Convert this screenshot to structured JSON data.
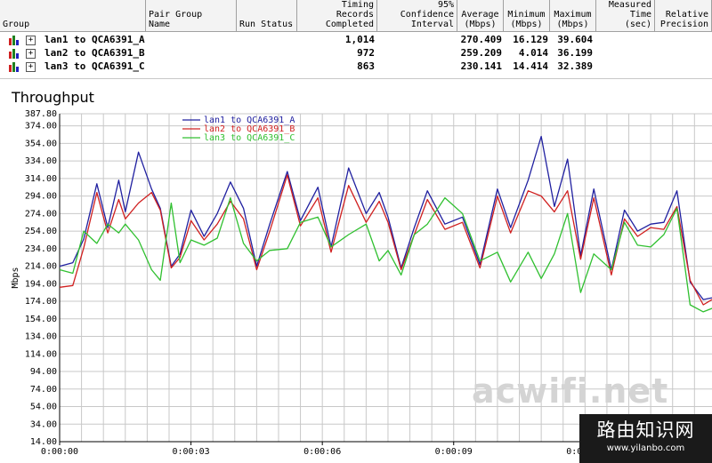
{
  "table": {
    "headers": [
      {
        "lines": [
          "Group"
        ]
      },
      {
        "lines": [
          "Pair Group",
          "Name"
        ]
      },
      {
        "lines": [
          "Run Status"
        ]
      },
      {
        "lines": [
          "Timing Records",
          "Completed"
        ]
      },
      {
        "lines": [
          "95% Confidence",
          "Interval"
        ]
      },
      {
        "lines": [
          "Average",
          "(Mbps)"
        ]
      },
      {
        "lines": [
          "Minimum",
          "(Mbps)"
        ]
      },
      {
        "lines": [
          "Maximum",
          "(Mbps)"
        ]
      },
      {
        "lines": [
          "Measured",
          "Time (sec)"
        ]
      },
      {
        "lines": [
          "Relative",
          "Precision"
        ]
      }
    ],
    "rows": [
      {
        "name": "lan1 to QCA6391_A",
        "records": "1,014",
        "average": "270.409",
        "minimum": "16.129",
        "maximum": "39.604"
      },
      {
        "name": "lan2 to QCA6391_B",
        "records": "972",
        "average": "259.209",
        "minimum": "4.014",
        "maximum": "36.199"
      },
      {
        "name": "lan3 to QCA6391_C",
        "records": "863",
        "average": "230.141",
        "minimum": "14.414",
        "maximum": "32.389"
      }
    ]
  },
  "chart_data": {
    "type": "line",
    "title": "Throughput",
    "ylabel": "Mbps",
    "xlabel": "",
    "ylim": [
      14.0,
      387.8
    ],
    "xlim": [
      0,
      14.9
    ],
    "y_ticks": [
      "387.80",
      "374.00",
      "354.00",
      "334.00",
      "314.00",
      "294.00",
      "274.00",
      "254.00",
      "234.00",
      "214.00",
      "194.00",
      "174.00",
      "154.00",
      "134.00",
      "114.00",
      "94.00",
      "74.00",
      "54.00",
      "34.00",
      "14.00"
    ],
    "x_ticks": [
      {
        "t": 0,
        "label": "0:00:00"
      },
      {
        "t": 3,
        "label": "0:00:03"
      },
      {
        "t": 6,
        "label": "0:00:06"
      },
      {
        "t": 9,
        "label": "0:00:09"
      },
      {
        "t": 12,
        "label": "0:00:12"
      }
    ],
    "grid": true,
    "legend": "top-left",
    "series": [
      {
        "name": "lan1 to QCA6391_A",
        "color": "#2020a0",
        "x": [
          0,
          0.3,
          0.55,
          0.85,
          1.1,
          1.35,
          1.5,
          1.8,
          2.1,
          2.3,
          2.55,
          2.75,
          3.0,
          3.3,
          3.6,
          3.9,
          4.2,
          4.5,
          4.8,
          5.2,
          5.5,
          5.9,
          6.2,
          6.6,
          7.0,
          7.3,
          7.5,
          7.8,
          8.1,
          8.4,
          8.8,
          9.2,
          9.6,
          10.0,
          10.3,
          10.7,
          11.0,
          11.3,
          11.6,
          11.9,
          12.2,
          12.6,
          12.9,
          13.2,
          13.5,
          13.8,
          14.1,
          14.4,
          14.7,
          14.9
        ],
        "y": [
          214,
          218,
          245,
          308,
          258,
          312,
          276,
          344,
          302,
          280,
          214,
          228,
          278,
          248,
          274,
          310,
          280,
          214,
          262,
          322,
          266,
          304,
          236,
          326,
          274,
          298,
          270,
          212,
          258,
          300,
          262,
          270,
          216,
          302,
          258,
          312,
          362,
          282,
          336,
          226,
          302,
          210,
          278,
          254,
          262,
          264,
          300,
          196,
          176,
          178
        ]
      },
      {
        "name": "lan2 to QCA6391_B",
        "color": "#d02020",
        "x": [
          0,
          0.3,
          0.55,
          0.85,
          1.1,
          1.35,
          1.5,
          1.8,
          2.1,
          2.3,
          2.55,
          2.75,
          3.0,
          3.3,
          3.6,
          3.9,
          4.2,
          4.5,
          4.8,
          5.2,
          5.5,
          5.9,
          6.2,
          6.6,
          7.0,
          7.3,
          7.5,
          7.8,
          8.1,
          8.4,
          8.8,
          9.2,
          9.6,
          10.0,
          10.3,
          10.7,
          11.0,
          11.3,
          11.6,
          11.9,
          12.2,
          12.6,
          12.9,
          13.2,
          13.5,
          13.8,
          14.1,
          14.4,
          14.7,
          14.9
        ],
        "y": [
          190,
          192,
          235,
          298,
          252,
          290,
          268,
          286,
          298,
          278,
          212,
          224,
          266,
          244,
          262,
          288,
          268,
          210,
          254,
          318,
          260,
          292,
          230,
          306,
          264,
          288,
          264,
          210,
          250,
          290,
          256,
          264,
          212,
          294,
          252,
          300,
          294,
          276,
          300,
          222,
          292,
          204,
          268,
          248,
          258,
          256,
          282,
          198,
          170,
          176
        ]
      },
      {
        "name": "lan3 to QCA6391_C",
        "color": "#30c030",
        "x": [
          0,
          0.3,
          0.55,
          0.85,
          1.1,
          1.35,
          1.5,
          1.8,
          2.1,
          2.3,
          2.55,
          2.75,
          3.0,
          3.3,
          3.6,
          3.9,
          4.2,
          4.5,
          4.8,
          5.2,
          5.5,
          5.9,
          6.2,
          6.6,
          7.0,
          7.3,
          7.5,
          7.8,
          8.1,
          8.4,
          8.8,
          9.2,
          9.6,
          10.0,
          10.3,
          10.7,
          11.0,
          11.3,
          11.6,
          11.9,
          12.2,
          12.6,
          12.9,
          13.2,
          13.5,
          13.8,
          14.1,
          14.4,
          14.7,
          14.9
        ],
        "y": [
          210,
          206,
          254,
          240,
          262,
          252,
          262,
          244,
          210,
          198,
          286,
          218,
          244,
          238,
          246,
          292,
          240,
          220,
          232,
          234,
          264,
          270,
          236,
          250,
          262,
          220,
          232,
          204,
          250,
          262,
          292,
          274,
          220,
          230,
          196,
          230,
          200,
          228,
          274,
          184,
          228,
          210,
          264,
          238,
          236,
          250,
          280,
          170,
          162,
          166
        ]
      }
    ]
  },
  "watermark": "acwifi.net",
  "brand": {
    "name": "路由知识网",
    "url": "www.yilanbo.com"
  }
}
